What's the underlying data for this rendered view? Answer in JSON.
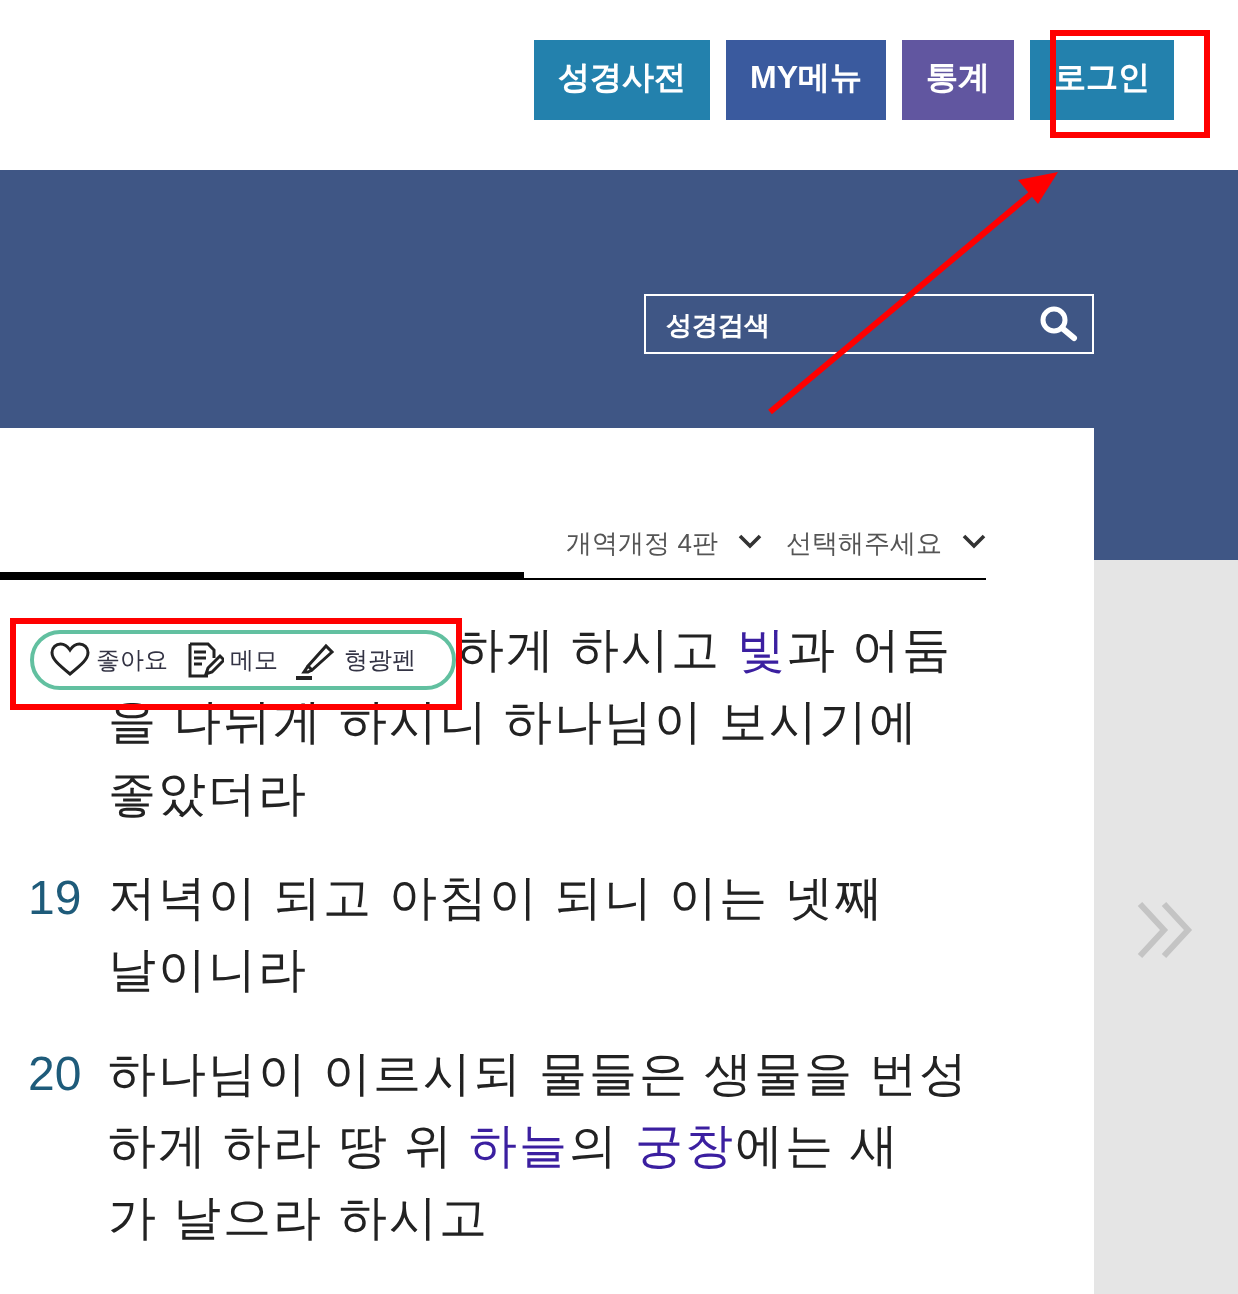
{
  "header_buttons": [
    {
      "label": "성경사전",
      "color": "#2381ad"
    },
    {
      "label": "MY메뉴",
      "color": "#3a5a9e"
    },
    {
      "label": "통계",
      "color": "#6156a0"
    },
    {
      "label": "로그인",
      "color": "#2381ad"
    }
  ],
  "search": {
    "placeholder": "성경검색"
  },
  "selects": [
    {
      "value": "개역개정 4판"
    },
    {
      "value": "선택해주세요"
    }
  ],
  "popup": [
    {
      "kind": "like",
      "label": "좋아요"
    },
    {
      "kind": "memo",
      "label": "메모"
    },
    {
      "kind": "highlight",
      "label": "형광펜"
    }
  ],
  "verses": [
    {
      "lines": [
        [
          {
            "text": "하게 하시고 ",
            "link": false
          },
          {
            "text": "빛",
            "link": true
          },
          {
            "text": "과 어둠",
            "link": false
          }
        ],
        [
          {
            "text": "을 나뉘게 하시니 하나님이 보시기에",
            "link": false
          }
        ],
        [
          {
            "text": "좋았더라",
            "link": false
          }
        ]
      ]
    },
    {
      "number": "19",
      "lines": [
        [
          {
            "text": "저녁이 되고 아침이 되니 이는 넷째",
            "link": false
          }
        ],
        [
          {
            "text": "날이니라",
            "link": false
          }
        ]
      ]
    },
    {
      "number": "20",
      "lines": [
        [
          {
            "text": "하나님이 이르시되 물들은 생물을 번성",
            "link": false
          }
        ],
        [
          {
            "text": "하게 하라 땅 위 ",
            "link": false
          },
          {
            "text": "하늘",
            "link": true
          },
          {
            "text": "의 ",
            "link": false
          },
          {
            "text": "궁창",
            "link": true
          },
          {
            "text": "에는 새",
            "link": false
          }
        ],
        [
          {
            "text": "가 날으라 하시고",
            "link": false
          }
        ]
      ]
    }
  ]
}
